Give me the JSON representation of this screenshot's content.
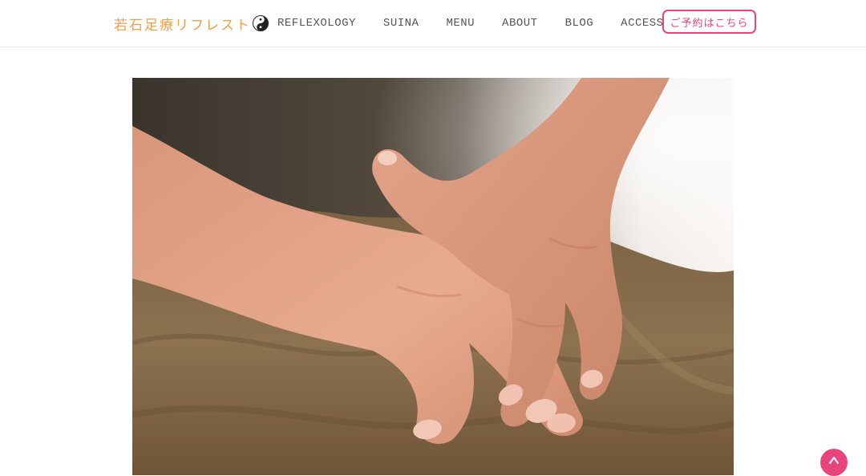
{
  "header": {
    "logo_text": "若石足療リフレスト",
    "logo_icon": "yin-yang-icon",
    "nav": [
      {
        "label": "REFLEXOLOGY"
      },
      {
        "label": "SUINA"
      },
      {
        "label": "MENU"
      },
      {
        "label": "ABOUT"
      },
      {
        "label": "BLOG"
      },
      {
        "label": "ACCESS"
      }
    ],
    "reserve_label": "ご予約はこちら"
  },
  "hero": {
    "image": "hands-on-towel-photo"
  },
  "back_to_top": {
    "icon": "chevron-up-icon"
  },
  "colors": {
    "logo": "#f0a04b",
    "accent": "#e8457c",
    "nav_text": "#555555",
    "towel": "#8a6e4b",
    "skin": "#e8a98e"
  }
}
